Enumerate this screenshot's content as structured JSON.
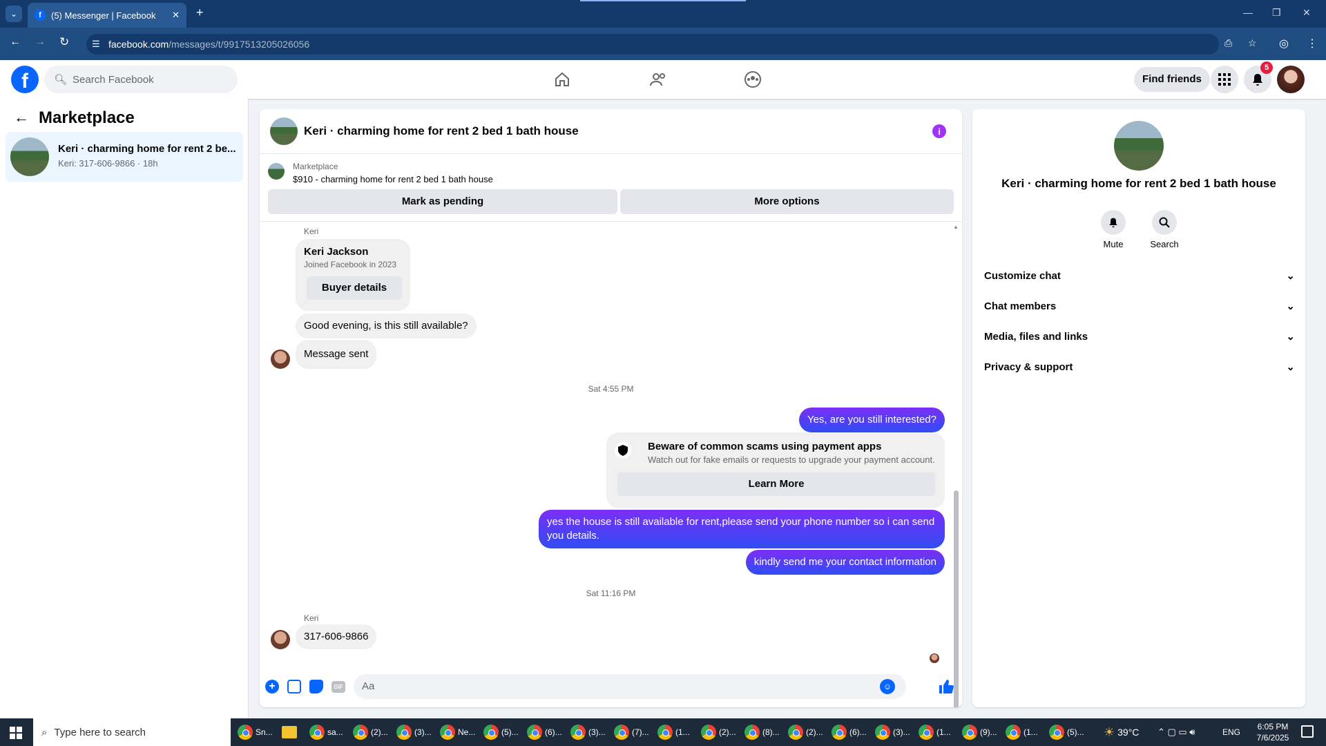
{
  "browser": {
    "tab_title": "(5) Messenger | Facebook",
    "url_domain": "facebook.com",
    "url_path": "/messages/t/9917513205026056"
  },
  "fb": {
    "search_placeholder": "Search Facebook",
    "find_friends": "Find friends",
    "notification_count": "5"
  },
  "left": {
    "title": "Marketplace",
    "conversation": {
      "title": "Keri · charming home for rent 2 be...",
      "subtitle": "Keri: 317-606-9866 · 18h"
    }
  },
  "chat": {
    "header_title": "Keri · charming home for rent 2 bed 1 bath house",
    "listing_source": "Marketplace",
    "listing_title": "$910 - charming home for rent 2 bed 1 bath house",
    "mark_pending": "Mark as pending",
    "more_options": "More options",
    "sender1": "Keri",
    "buyer_name": "Keri Jackson",
    "buyer_joined": "Joined Facebook in 2023",
    "buyer_details": "Buyer details",
    "msg1": "Good evening, is this still available?",
    "msg2": "Message sent",
    "time1": "Sat 4:55 PM",
    "msg3": "Yes, are you still interested?",
    "scam_title": "Beware of common scams using payment apps",
    "scam_text": "Watch out for fake emails or requests to upgrade your payment account.",
    "learn_more": "Learn More",
    "msg4": "yes the house is still available for rent,please send your phone number so i can send you details.",
    "msg5": "kindly send me your contact information",
    "time2": "Sat 11:16 PM",
    "sender2": "Keri",
    "msg6": "317-606-9866",
    "composer_placeholder": "Aa",
    "gif_label": "GIF"
  },
  "right": {
    "title": "Keri · charming home for rent 2 bed 1 bath house",
    "mute": "Mute",
    "search": "Search",
    "sections": [
      "Customize chat",
      "Chat members",
      "Media, files and links",
      "Privacy & support"
    ]
  },
  "taskbar": {
    "search_placeholder": "Type here to search",
    "apps": [
      "Sn...",
      "sa...",
      "(2)...",
      "(3)...",
      "Ne...",
      "(5)...",
      "(6)...",
      "(3)...",
      "(7)...",
      "(1...",
      "(2)...",
      "(8)...",
      "(2)...",
      "(6)...",
      "(3)...",
      "(1...",
      "(9)...",
      "(1...",
      "(5)..."
    ],
    "weather": "39°C",
    "lang": "ENG",
    "time": "6:05 PM",
    "date": "7/6/2025"
  },
  "colors": {
    "fb_blue": "#0866ff",
    "messenger_purple": "#7b2ff7",
    "badge_red": "#e41e3f"
  }
}
